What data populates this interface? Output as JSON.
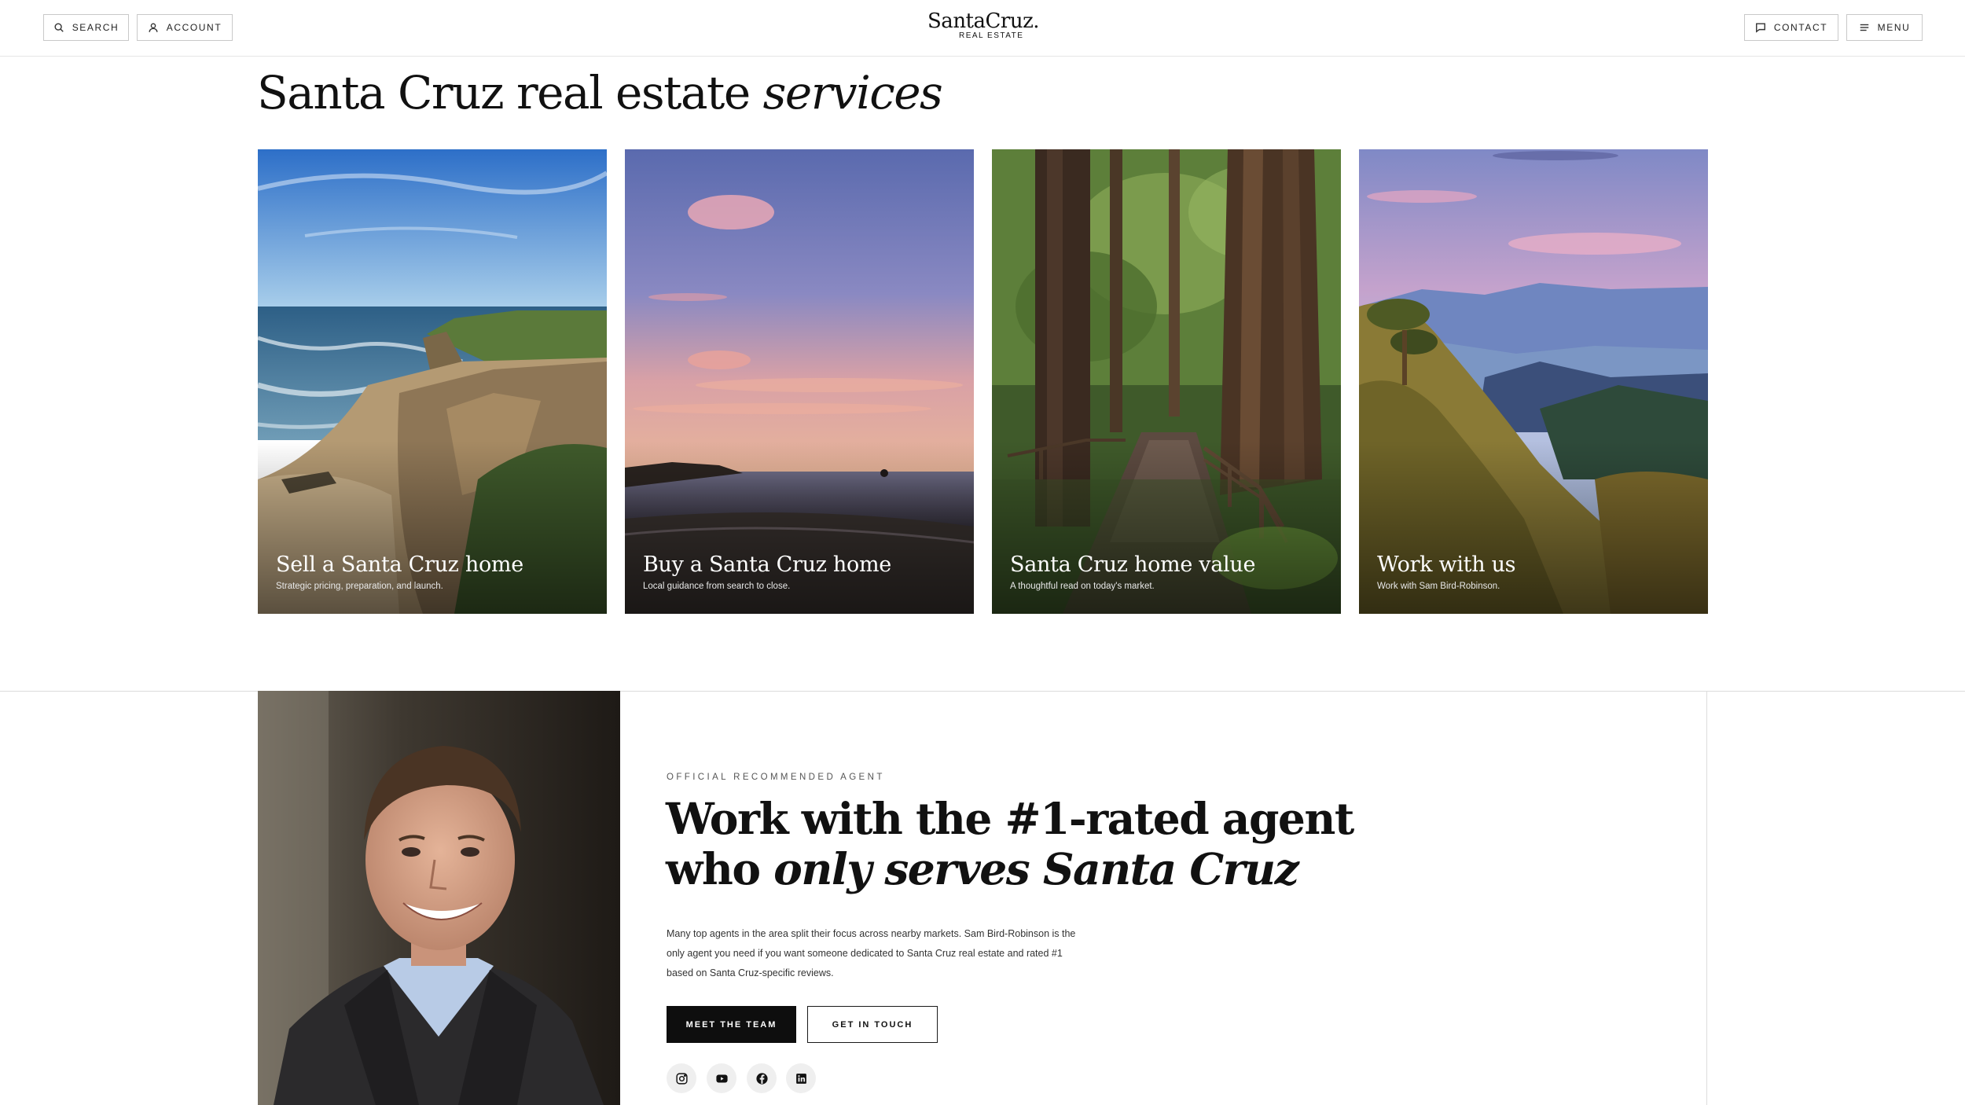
{
  "header": {
    "search_label": "SEARCH",
    "account_label": "ACCOUNT",
    "logo_main": "SantaCruz.",
    "logo_sub": "REAL ESTATE",
    "contact_label": "CONTACT",
    "menu_label": "MENU"
  },
  "services": {
    "title_plain": "Santa Cruz real estate ",
    "title_italic": "services",
    "cards": [
      {
        "title": "Sell a Santa Cruz home",
        "subtitle": "Strategic pricing, preparation, and launch."
      },
      {
        "title": "Buy a Santa Cruz home",
        "subtitle": "Local guidance from search to close."
      },
      {
        "title": "Santa Cruz home value",
        "subtitle": "A thoughtful read on today's market."
      },
      {
        "title": "Work with us",
        "subtitle": "Work with Sam Bird-Robinson."
      }
    ]
  },
  "agent": {
    "eyebrow": "OFFICIAL RECOMMENDED AGENT",
    "title_line1": "Work with the #1-rated agent",
    "title_line2_plain": "who ",
    "title_line2_italic": "only serves Santa Cruz",
    "body": "Many top agents in the area split their focus across nearby markets. Sam Bird-Robinson is the only agent you need if you want someone dedicated to Santa Cruz real estate and rated #1 based on Santa Cruz-specific reviews.",
    "primary_button": "MEET THE TEAM",
    "secondary_button": "GET IN TOUCH",
    "social": [
      "instagram-icon",
      "youtube-icon",
      "facebook-icon",
      "linkedin-icon"
    ]
  }
}
